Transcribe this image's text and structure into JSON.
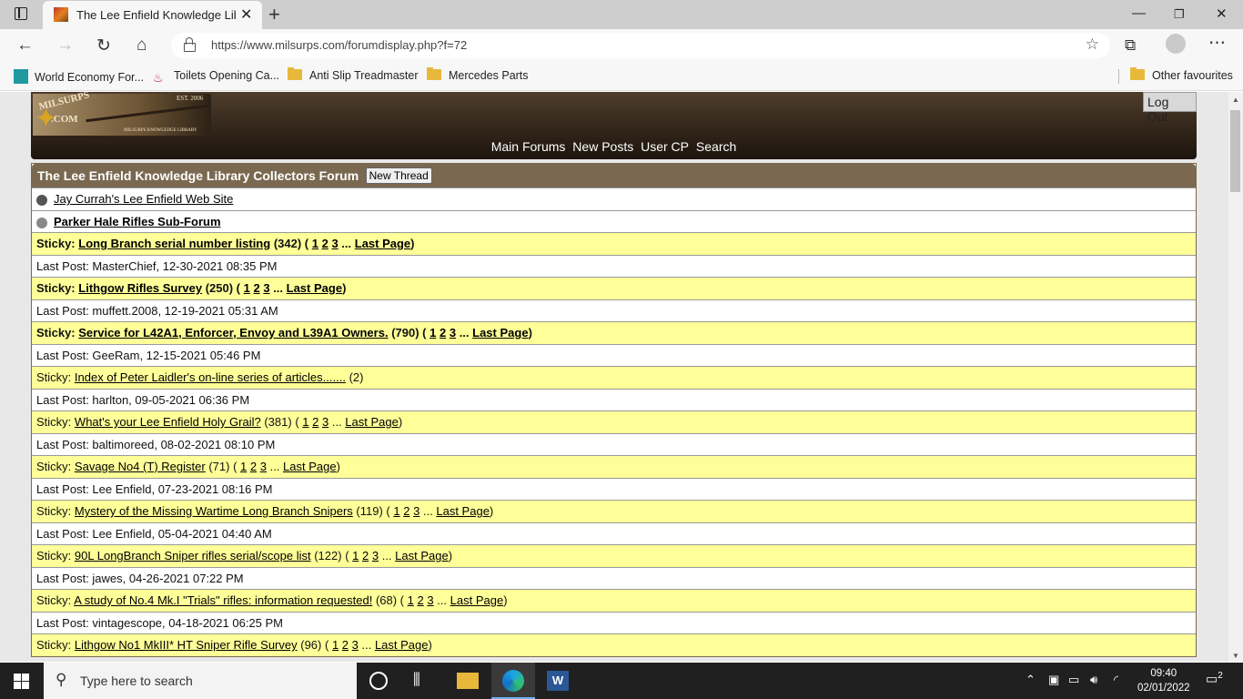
{
  "browser": {
    "tab_title": "The Lee Enfield Knowledge Library Collectors Forum",
    "url": "https://www.milsurps.com/forumdisplay.php?f=72",
    "bookmarks": [
      {
        "label": "World Economy For..."
      },
      {
        "label": "Toilets Opening Ca..."
      },
      {
        "label": "Anti Slip Treadmaster"
      },
      {
        "label": "Mercedes Parts"
      }
    ],
    "other_favourites": "Other favourites"
  },
  "site": {
    "logo": {
      "line1": "MILSURPS",
      "line2": ".COM",
      "est": "EST. 2006",
      "tagline": "MILSURPS KNOWLEDGE LIBRARY"
    },
    "logout": "Log Out",
    "nav": [
      "Main Forums",
      "New Posts",
      "User CP",
      "Search"
    ]
  },
  "forum": {
    "title": "The Lee Enfield Knowledge Library Collectors Forum",
    "new_thread": "New Thread",
    "subforums": [
      {
        "label": "Jay Currah's Lee Enfield Web Site",
        "bold": false
      },
      {
        "label": "Parker Hale Rifles Sub-Forum",
        "bold": true
      }
    ],
    "threads": [
      {
        "prefix": "Sticky:",
        "title": "Long Branch serial number listing",
        "count": "(342)",
        "pages": [
          "1",
          "2",
          "3"
        ],
        "last_page": "Last Page",
        "last_post": "Last Post: MasterChief, 12-30-2021 08:35 PM",
        "bold": true
      },
      {
        "prefix": "Sticky:",
        "title": "Lithgow Rifles Survey",
        "count": "(250)",
        "pages": [
          "1",
          "2",
          "3"
        ],
        "last_page": "Last Page",
        "last_post": "Last Post: muffett.2008, 12-19-2021 05:31 AM",
        "bold": true
      },
      {
        "prefix": "Sticky:",
        "title": "Service for L42A1, Enforcer, Envoy and L39A1 Owners.",
        "count": "(790)",
        "pages": [
          "1",
          "2",
          "3"
        ],
        "last_page": "Last Page",
        "last_post": "Last Post: GeeRam, 12-15-2021 05:46 PM",
        "bold": true
      },
      {
        "prefix": "Sticky:",
        "title": "Index of Peter Laidler's on-line series of articles.......",
        "count": "(2)",
        "pages": [],
        "last_page": "",
        "last_post": "Last Post: harlton, 09-05-2021 06:36 PM",
        "bold": false
      },
      {
        "prefix": "Sticky:",
        "title": "What's your Lee Enfield Holy Grail?",
        "count": "(381)",
        "pages": [
          "1",
          "2",
          "3"
        ],
        "last_page": "Last Page",
        "last_post": "Last Post: baltimoreed, 08-02-2021 08:10 PM",
        "bold": false
      },
      {
        "prefix": "Sticky:",
        "title": "Savage No4 (T) Register",
        "count": "(71)",
        "pages": [
          "1",
          "2",
          "3"
        ],
        "last_page": "Last Page",
        "last_post": "Last Post: Lee Enfield, 07-23-2021 08:16 PM",
        "bold": false
      },
      {
        "prefix": "Sticky:",
        "title": "Mystery of the Missing Wartime Long Branch Snipers",
        "count": "(119)",
        "pages": [
          "1",
          "2",
          "3"
        ],
        "last_page": "Last Page",
        "last_post": "Last Post: Lee Enfield, 05-04-2021 04:40 AM",
        "bold": false
      },
      {
        "prefix": "Sticky:",
        "title": "90L LongBranch Sniper rifles serial/scope list",
        "count": "(122)",
        "pages": [
          "1",
          "2",
          "3"
        ],
        "last_page": "Last Page",
        "last_post": "Last Post: jawes, 04-26-2021 07:22 PM",
        "bold": false
      },
      {
        "prefix": "Sticky:",
        "title": "A study of No.4 Mk.I \"Trials\" rifles: information requested!",
        "count": "(68)",
        "pages": [
          "1",
          "2",
          "3"
        ],
        "last_page": "Last Page",
        "last_post": "Last Post: vintagescope, 04-18-2021 06:25 PM",
        "bold": false
      },
      {
        "prefix": "Sticky:",
        "title": "Lithgow No1 MkIII* HT Sniper Rifle Survey",
        "count": "(96)",
        "pages": [
          "1",
          "2",
          "3"
        ],
        "last_page": "Last Page",
        "last_post": "",
        "bold": false
      }
    ]
  },
  "taskbar": {
    "search_placeholder": "Type here to search",
    "time": "09:40",
    "date": "02/01/2022",
    "notifications": "2"
  }
}
